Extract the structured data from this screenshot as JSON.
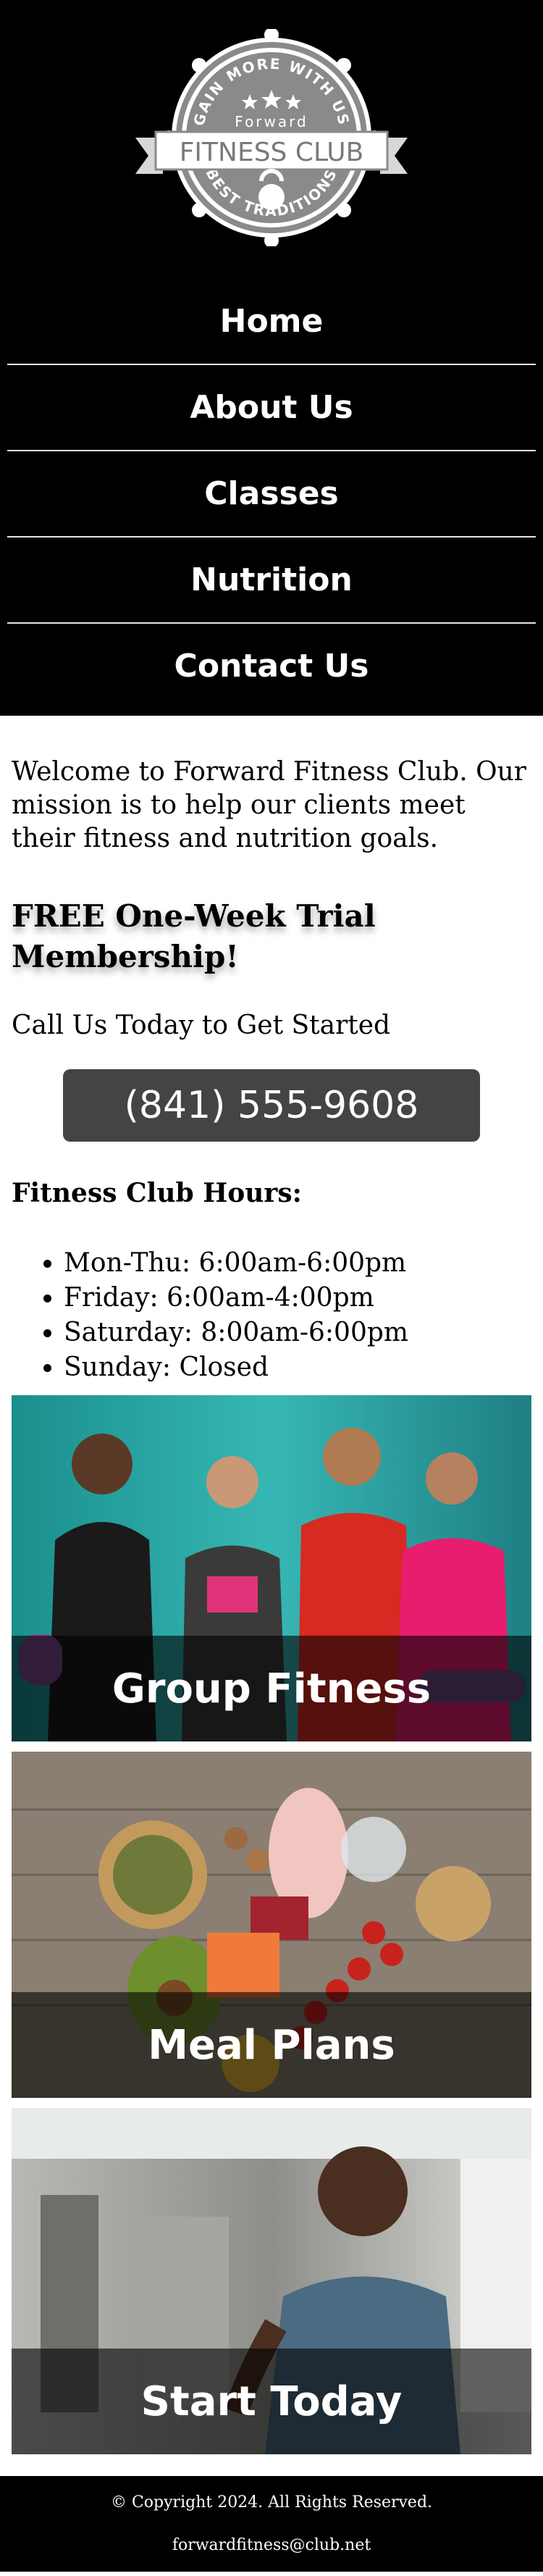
{
  "logo": {
    "arc_top": "GAIN MORE WITH US",
    "brand_small": "Forward",
    "brand_main": "FITNESS CLUB",
    "arc_bottom": "BEST TRADITIONS"
  },
  "nav": {
    "items": [
      {
        "label": "Home"
      },
      {
        "label": "About Us"
      },
      {
        "label": "Classes"
      },
      {
        "label": "Nutrition"
      },
      {
        "label": "Contact Us"
      }
    ]
  },
  "main": {
    "welcome": "Welcome to Forward Fitness Club. Our mission is to help our clients meet their fitness and nutrition goals.",
    "trial_heading": "FREE One-Week Trial Membership!",
    "call_text": "Call Us Today to Get Started",
    "phone": "(841) 555-9608",
    "hours_heading": "Fitness Club Hours:",
    "hours": [
      "Mon-Thu: 6:00am-6:00pm",
      "Friday: 6:00am-4:00pm",
      "Saturday: 8:00am-6:00pm",
      "Sunday: Closed"
    ]
  },
  "cards": [
    {
      "label": "Group Fitness",
      "image": "group-fitness-photo"
    },
    {
      "label": "Meal Plans",
      "image": "healthy-food-photo"
    },
    {
      "label": "Start Today",
      "image": "trainer-photo"
    }
  ],
  "footer": {
    "copyright": "© Copyright 2024. All Rights Reserved.",
    "email": "forwardfitness@club.net"
  }
}
